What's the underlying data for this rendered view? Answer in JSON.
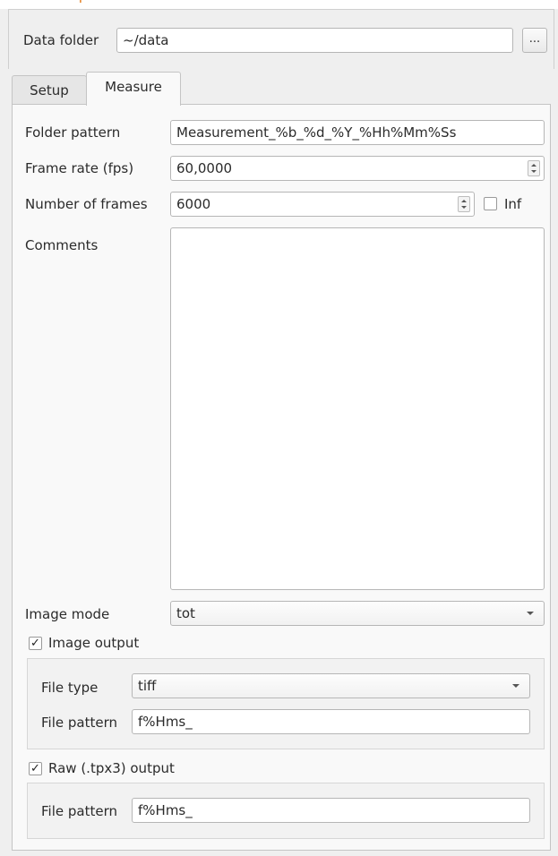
{
  "header": {
    "accent_fragment": "p",
    "data_folder_label": "Data folder",
    "data_folder_value": "~/data",
    "browse_button_label": "..."
  },
  "tabs": [
    {
      "label": "Setup",
      "active": false
    },
    {
      "label": "Measure",
      "active": true
    }
  ],
  "measure": {
    "folder_pattern_label": "Folder pattern",
    "folder_pattern_value": "Measurement_%b_%d_%Y_%Hh%Mm%Ss",
    "frame_rate_label": "Frame rate (fps)",
    "frame_rate_value": "60,0000",
    "num_frames_label": "Number of frames",
    "num_frames_value": "6000",
    "inf_label": "Inf",
    "inf_checked": false,
    "comments_label": "Comments",
    "comments_value": "",
    "image_mode_label": "Image mode",
    "image_mode_value": "tot",
    "image_output": {
      "label": "Image output",
      "checked": true,
      "check_glyph": "✓",
      "file_type_label": "File type",
      "file_type_value": "tiff",
      "file_pattern_label": "File pattern",
      "file_pattern_value": "f%Hms_"
    },
    "raw_output": {
      "label": "Raw (.tpx3) output",
      "checked": true,
      "check_glyph": "✓",
      "file_pattern_label": "File pattern",
      "file_pattern_value": "f%Hms_"
    }
  },
  "colors": {
    "accent_orange": "#e06c00",
    "window_bg": "#efefef",
    "panel_bg": "#f9f9f9",
    "field_border": "#b6b6b6"
  }
}
